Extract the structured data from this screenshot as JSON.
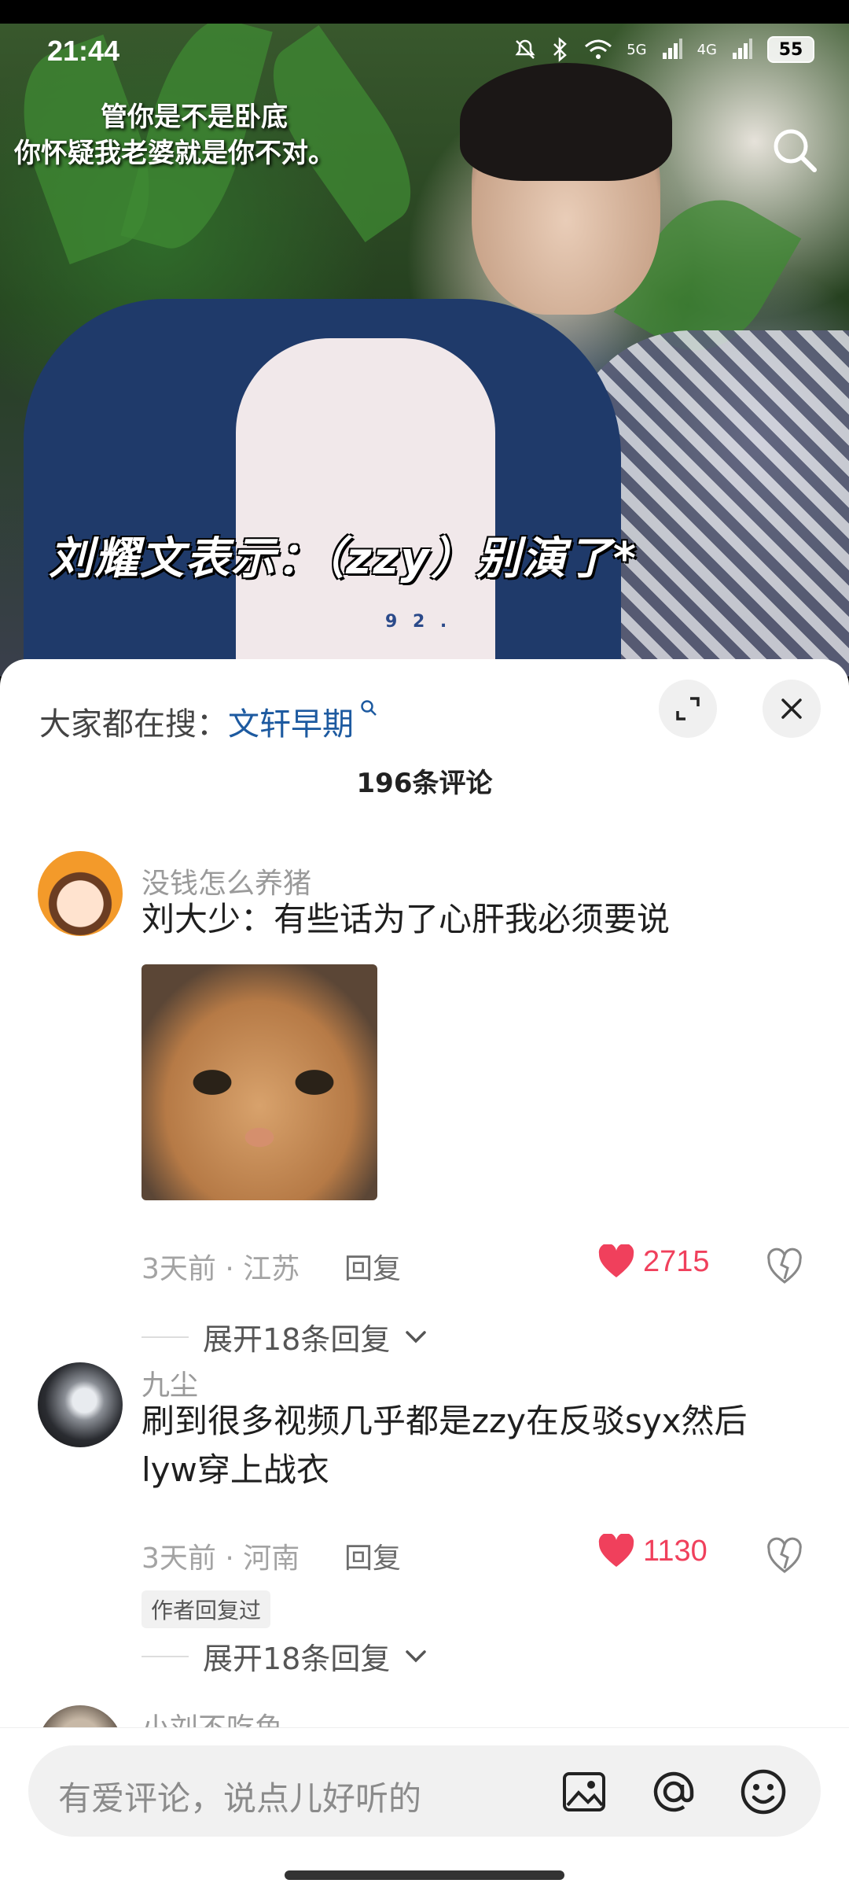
{
  "status_bar": {
    "time": "21:44",
    "network_5g": "5G",
    "network_4g": "4G",
    "battery": "55"
  },
  "video": {
    "caption_top_line1": "管你是不是卧底",
    "caption_top_line2": "你怀疑我老婆就是你不对。",
    "caption_main": "刘耀文表示：（zzy）别演了*",
    "watermark": "9 2 ."
  },
  "comment_sheet": {
    "suggest_prefix": "大家都在搜：",
    "suggest_term": "文轩早期",
    "count_title": "196条评论",
    "input_placeholder": "有爱评论，说点儿好听的"
  },
  "comments": [
    {
      "name": "没钱怎么养猪",
      "text": "刘大少：有些话为了心肝我必须要说",
      "meta": "3天前 · 江苏",
      "reply_label": "回复",
      "likes": "2715",
      "expand_label": "展开18条回复"
    },
    {
      "name": "九尘",
      "text": "刷到很多视频几乎都是zzy在反驳syx然后lyw穿上战衣",
      "meta": "3天前 · 河南",
      "reply_label": "回复",
      "likes": "1130",
      "author_tag": "作者回复过",
      "expand_label": "展开18条回复"
    },
    {
      "name": "小刘不吃鱼"
    }
  ],
  "colors": {
    "like_red": "#f0405c",
    "suggest_blue": "#1d5aa0",
    "sheet_bg": "#ffffff"
  },
  "icons": [
    "search-icon",
    "expand-icon",
    "close-icon",
    "heart-icon",
    "dislike-icon",
    "image-icon",
    "at-icon",
    "emoji-icon",
    "chevron-down-icon",
    "mute-icon",
    "bluetooth-icon",
    "wifi-icon",
    "signal-icon"
  ]
}
